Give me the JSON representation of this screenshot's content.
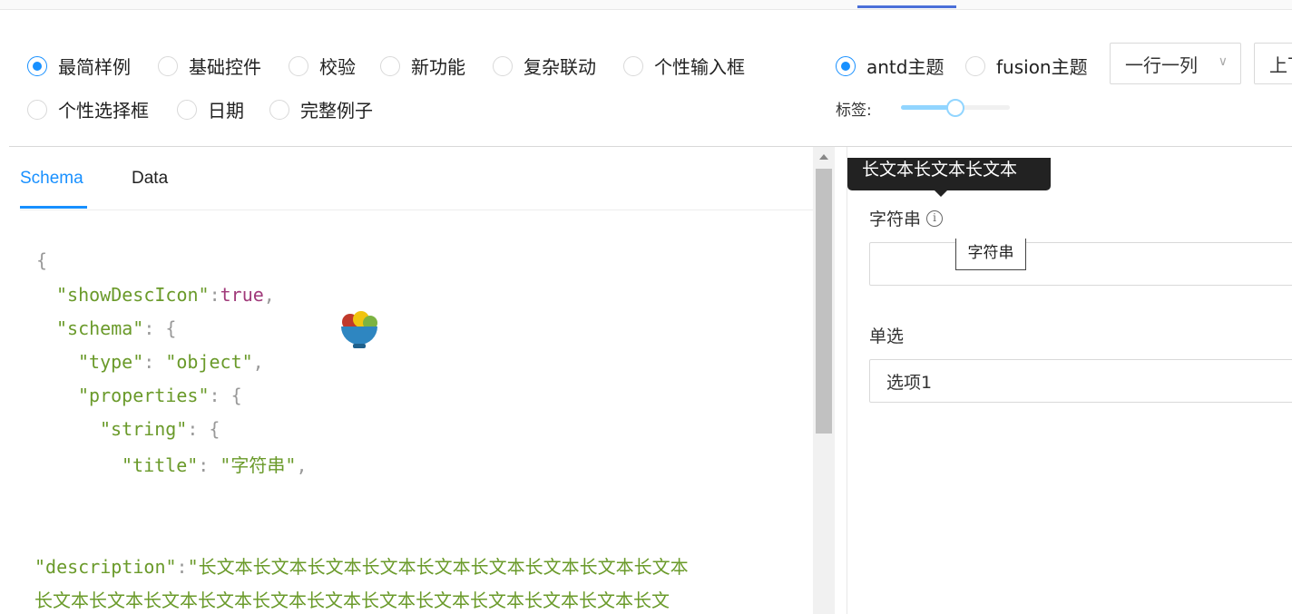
{
  "demo_options": [
    {
      "label": "最简样例",
      "checked": true
    },
    {
      "label": "基础控件",
      "checked": false
    },
    {
      "label": "校验",
      "checked": false
    },
    {
      "label": "新功能",
      "checked": false
    },
    {
      "label": "复杂联动",
      "checked": false
    },
    {
      "label": "个性输入框",
      "checked": false
    },
    {
      "label": "个性选择框",
      "checked": false
    },
    {
      "label": "日期",
      "checked": false
    },
    {
      "label": "完整例子",
      "checked": false
    }
  ],
  "theme_options": [
    {
      "label": "antd主题",
      "checked": true
    },
    {
      "label": "fusion主题",
      "checked": false
    }
  ],
  "layout_select": {
    "value": "一行一列"
  },
  "label_select": {
    "value": "上下"
  },
  "label_slider": {
    "label": "标签:",
    "value_percent": 50
  },
  "editor_tabs": {
    "schema": "Schema",
    "data": "Data"
  },
  "code": {
    "brace_open": "{",
    "show_desc_key": "\"showDescIcon\"",
    "show_desc_sep": ":",
    "show_desc_val": "true",
    "comma": ",",
    "schema_key": "\"schema\"",
    "schema_sep": ": {",
    "type_key": "\"type\"",
    "type_sep": ": ",
    "type_val": "\"object\"",
    "properties_key": "\"properties\"",
    "properties_sep": ": {",
    "string_key": "\"string\"",
    "string_sep": ": {",
    "title_key": "\"title\"",
    "title_sep": ": ",
    "title_val": "\"字符串\"",
    "desc_key": "\"description\"",
    "desc_sep": ":",
    "desc_line1": "\"长文本长文本长文本长文本长文本长文本长文本长文本长文本",
    "desc_line2": "长文本长文本长文本长文本长文本长文本长文本长文本长文本长文本长文本长文"
  },
  "preview": {
    "tooltip_text": "长文本长文本长文本",
    "field1_label": "字符串",
    "info_icon": "i",
    "field1_tip": "字符串",
    "field1_value": "",
    "field2_label": "单选",
    "field2_value": "选项1"
  }
}
